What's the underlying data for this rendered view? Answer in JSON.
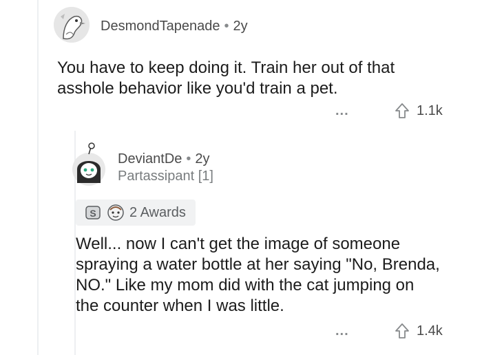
{
  "comments": [
    {
      "username": "DesmondTapenade",
      "age": "2y",
      "body": "You have to keep doing it. Train her out of that asshole behavior like you'd train a pet.",
      "more_label": "...",
      "score": "1.1k"
    },
    {
      "username": "DeviantDe",
      "age": "2y",
      "flair": "Partassipant [1]",
      "awards_label": "2 Awards",
      "body": "Well... now I can't get the image of someone spraying a water bottle at her saying \"No, Brenda, NO.\" Like my mom did with the cat jumping on the counter when I was little.",
      "more_label": "...",
      "score": "1.4k"
    }
  ],
  "separator": "•",
  "icons": {
    "avatar_1": "bird-avatar",
    "avatar_2": "snoo-avatar",
    "upvote": "upvote-arrow-icon",
    "award_1": "silver-award-icon",
    "award_2": "award-badge-icon"
  }
}
